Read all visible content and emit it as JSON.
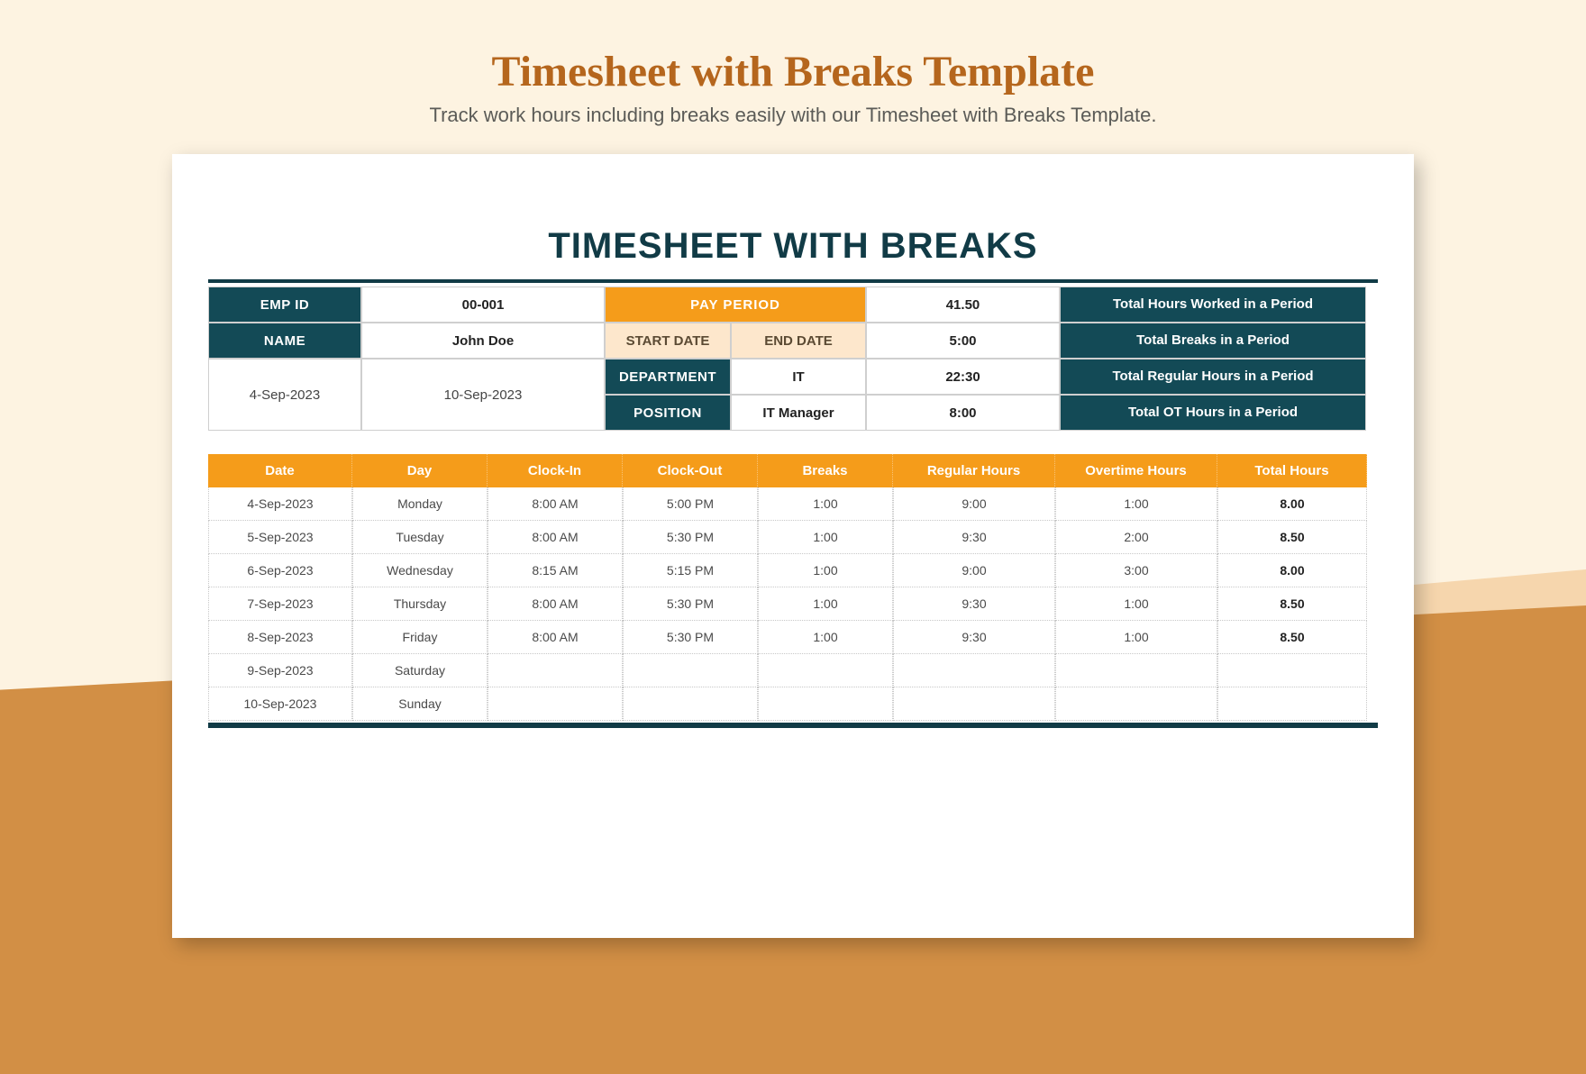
{
  "page": {
    "title": "Timesheet with Breaks Template",
    "subtitle": "Track work hours including breaks easily with our Timesheet with Breaks Template."
  },
  "sheet": {
    "title": "TIMESHEET WITH BREAKS",
    "labels": {
      "emp_id": "EMP ID",
      "name": "NAME",
      "department": "DEPARTMENT",
      "position": "POSITION",
      "pay_period": "PAY PERIOD",
      "start_date": "START DATE",
      "end_date": "END DATE",
      "total_worked": "Total Hours Worked in a Period",
      "total_breaks": "Total Breaks in a Period",
      "total_regular": "Total Regular Hours in a Period",
      "total_ot": "Total OT Hours in a Period"
    },
    "employee": {
      "emp_id": "00-001",
      "name": "John Doe",
      "department": "IT",
      "position": "IT Manager"
    },
    "period": {
      "start": "4-Sep-2023",
      "end": "10-Sep-2023"
    },
    "summary": {
      "worked": "41.50",
      "breaks": "5:00",
      "regular": "22:30",
      "ot": "8:00"
    }
  },
  "table": {
    "headers": [
      "Date",
      "Day",
      "Clock-In",
      "Clock-Out",
      "Breaks",
      "Regular Hours",
      "Overtime Hours",
      "Total Hours"
    ],
    "rows": [
      {
        "date": "4-Sep-2023",
        "day": "Monday",
        "in": "8:00 AM",
        "out": "5:00 PM",
        "breaks": "1:00",
        "reg": "9:00",
        "ot": "1:00",
        "total": "8.00"
      },
      {
        "date": "5-Sep-2023",
        "day": "Tuesday",
        "in": "8:00 AM",
        "out": "5:30 PM",
        "breaks": "1:00",
        "reg": "9:30",
        "ot": "2:00",
        "total": "8.50"
      },
      {
        "date": "6-Sep-2023",
        "day": "Wednesday",
        "in": "8:15 AM",
        "out": "5:15 PM",
        "breaks": "1:00",
        "reg": "9:00",
        "ot": "3:00",
        "total": "8.00"
      },
      {
        "date": "7-Sep-2023",
        "day": "Thursday",
        "in": "8:00 AM",
        "out": "5:30 PM",
        "breaks": "1:00",
        "reg": "9:30",
        "ot": "1:00",
        "total": "8.50"
      },
      {
        "date": "8-Sep-2023",
        "day": "Friday",
        "in": "8:00 AM",
        "out": "5:30 PM",
        "breaks": "1:00",
        "reg": "9:30",
        "ot": "1:00",
        "total": "8.50"
      },
      {
        "date": "9-Sep-2023",
        "day": "Saturday",
        "in": "",
        "out": "",
        "breaks": "",
        "reg": "",
        "ot": "",
        "total": ""
      },
      {
        "date": "10-Sep-2023",
        "day": "Sunday",
        "in": "",
        "out": "",
        "breaks": "",
        "reg": "",
        "ot": "",
        "total": ""
      }
    ]
  }
}
